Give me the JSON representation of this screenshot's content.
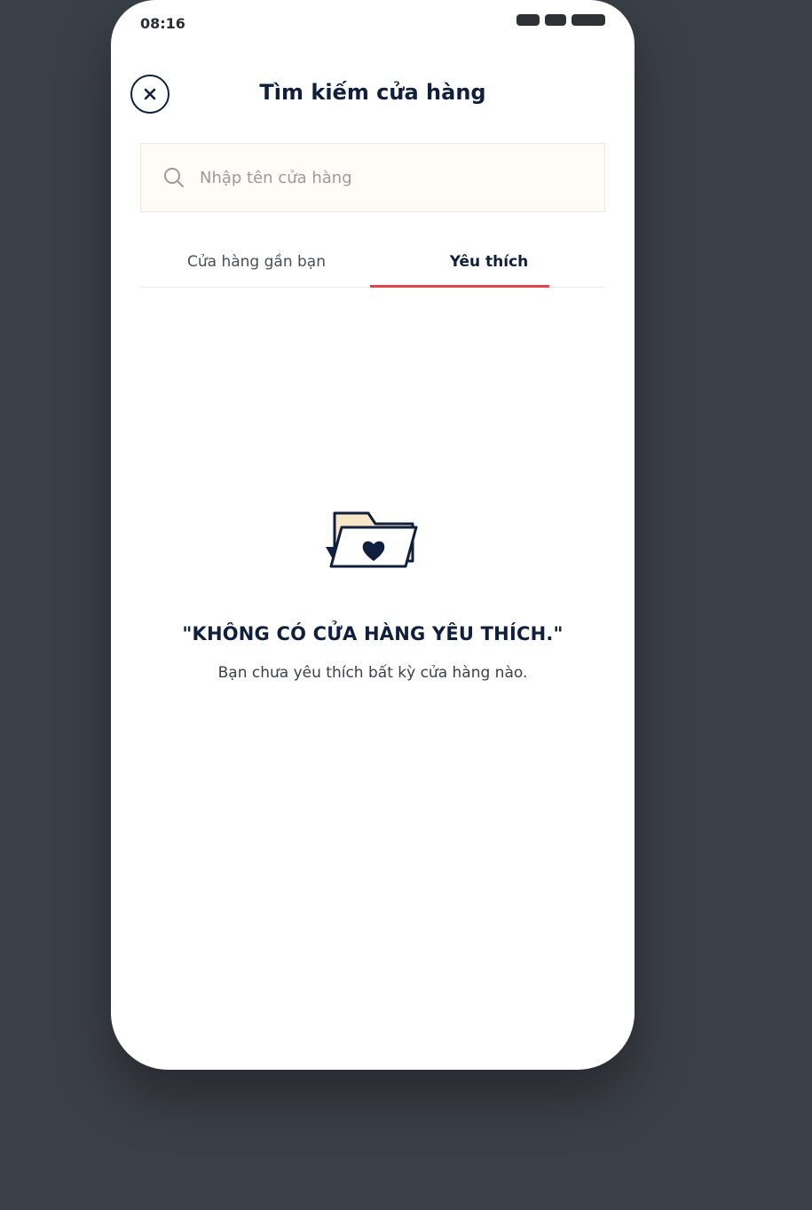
{
  "status_bar": {
    "time": "08:16"
  },
  "header": {
    "title": "Tìm kiếm cửa hàng",
    "close_icon": "close-icon"
  },
  "search": {
    "placeholder": "Nhập tên cửa hàng",
    "value": "",
    "icon": "search-icon"
  },
  "tabs": [
    {
      "label": "Cửa hàng gần bạn",
      "active": false
    },
    {
      "label": "Yêu thích",
      "active": true
    }
  ],
  "empty_state": {
    "icon": "folder-heart-icon",
    "title": "\"KHÔNG CÓ CỬA HÀNG YÊU THÍCH.\"",
    "subtitle": "Bạn chưa yêu thích bất kỳ cửa hàng nào."
  },
  "colors": {
    "primary": "#0f1f3d",
    "accent": "#e8424e",
    "folder_back": "#f7e6c7"
  }
}
